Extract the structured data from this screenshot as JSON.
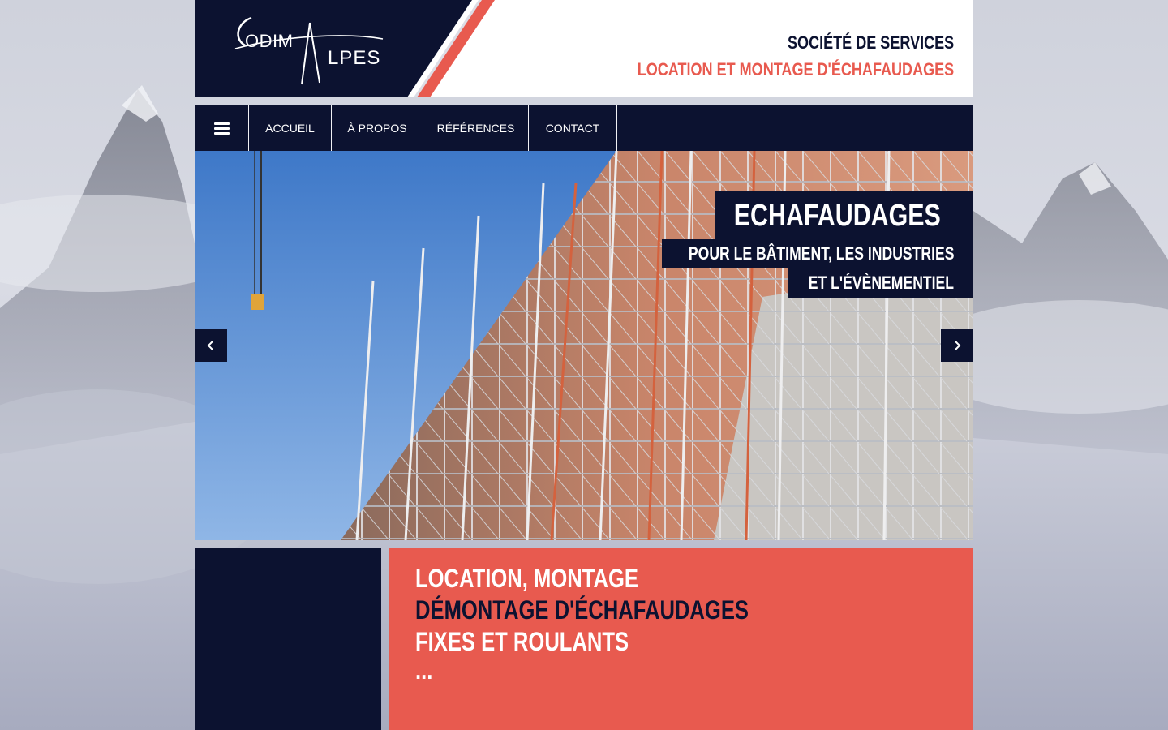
{
  "colors": {
    "navy": "#0c1230",
    "coral": "#e85a4f",
    "white": "#ffffff"
  },
  "header": {
    "logo": {
      "word1": "ODIM",
      "word2": "LPES",
      "text": "CODIM ALPES"
    },
    "tagline_line1": "SOCIÉTÉ DE SERVICES",
    "tagline_line2": "LOCATION ET MONTAGE D'ÉCHAFAUDAGES"
  },
  "nav": {
    "menu_icon": "hamburger-icon",
    "items": [
      {
        "label": "ACCUEIL"
      },
      {
        "label": "À PROPOS"
      },
      {
        "label": "RÉFÉRENCES"
      },
      {
        "label": "CONTACT"
      }
    ]
  },
  "slider": {
    "image": "scaffolding on building facade under blue sky",
    "caption_title": "ECHAFAUDAGES",
    "caption_line1": "POUR LE BÂTIMENT, LES INDUSTRIES",
    "caption_line2": "ET L'ÉVÈNEMENTIEL",
    "prev_icon": "chevron-left-icon",
    "next_icon": "chevron-right-icon"
  },
  "promo": {
    "line1": "LOCATION, MONTAGE",
    "line2": "DÉMONTAGE D'ÉCHAFAUDAGES",
    "line3": "FIXES ET ROULANTS",
    "line4": "..."
  }
}
